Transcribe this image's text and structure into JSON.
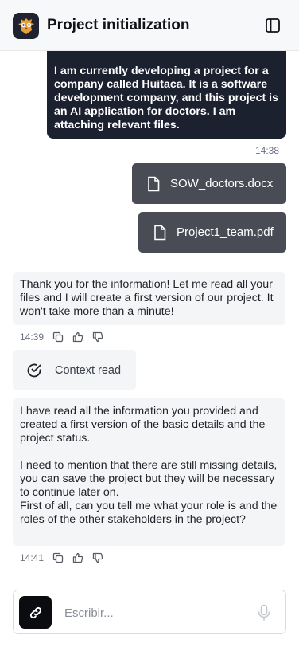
{
  "header": {
    "title": "Project initialization",
    "logo_icon": "owl-logo-icon",
    "sidebar_icon": "sidebar-toggle-icon"
  },
  "messages": {
    "user_text": "I am currently developing a project for a company called Huitaca. It is a software development company, and this project is an AI application for doctors. I am attaching relevant files.",
    "user_time": "14:38",
    "files": [
      {
        "name": "SOW_doctors.docx",
        "icon": "file-icon"
      },
      {
        "name": "Project1_team.pdf",
        "icon": "file-icon"
      }
    ],
    "bot1_text": "Thank you for the information! Let me read all your files and I will create a first version of our project. It won't take more than a minute!",
    "bot1_time": "14:39",
    "context_label": "Context read",
    "bot2_text": "I have read all the information you provided and created a first version of the basic details and the project status.\n\nI need to mention that there are still missing details, you can save the project but they will be necessary to continue later on.\nFirst of all, can you tell me what your role is and the roles of the other stakeholders in the project?",
    "bot2_time": "14:41"
  },
  "composer": {
    "placeholder": "Escribir...",
    "attach_icon": "link-icon",
    "mic_icon": "microphone-icon"
  },
  "colors": {
    "user_bubble": "#1c2130",
    "file_chip": "#4a4c55",
    "bot_bubble": "#f4f5f7"
  }
}
